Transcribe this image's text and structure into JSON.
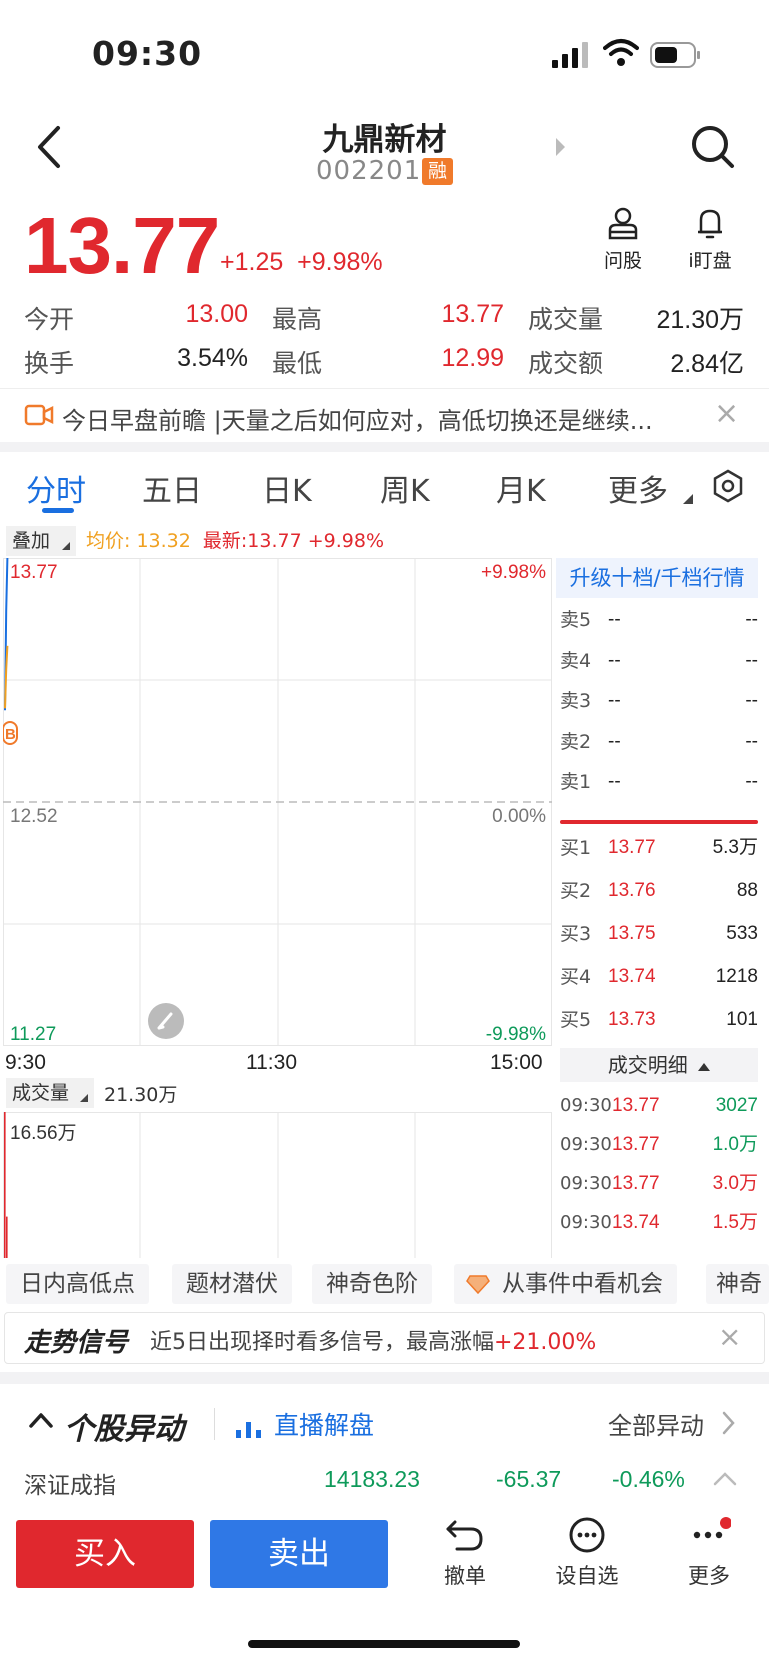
{
  "status": {
    "time": "09:30"
  },
  "header": {
    "name": "九鼎新材",
    "code": "002201",
    "badge": "融"
  },
  "price": {
    "last": "13.77",
    "change": "+1.25",
    "change_pct": "+9.98%"
  },
  "actions": {
    "ask_stock": "问股",
    "watch": "i盯盘"
  },
  "quote": {
    "open_label": "今开",
    "open": "13.00",
    "high_label": "最高",
    "high": "13.77",
    "volume_label": "成交量",
    "volume": "21.30万",
    "turnover_label": "换手",
    "turnover": "3.54%",
    "low_label": "最低",
    "low": "12.99",
    "amount_label": "成交额",
    "amount": "2.84亿"
  },
  "news": {
    "text": "今日早盘前瞻 |天量之后如何应对，高低切换还是继续..."
  },
  "tabs": [
    "分时",
    "五日",
    "日K",
    "周K",
    "月K",
    "更多"
  ],
  "chart_bar": {
    "overlay": "叠加",
    "avg": "均价: 13.32",
    "latest": "最新:13.77 +9.98%"
  },
  "chart_data": {
    "type": "line",
    "x_ticks": [
      "9:30",
      "11:30",
      "15:00"
    ],
    "y_left": [
      "13.77",
      "12.52",
      "11.27"
    ],
    "y_right": [
      "+9.98%",
      "0.00%",
      "-9.98%"
    ],
    "ylim": [
      11.27,
      13.77
    ],
    "series": [
      {
        "name": "最新",
        "x": [
          "9:30",
          "9:31",
          "9:32"
        ],
        "values": [
          12.99,
          13.5,
          13.77
        ]
      },
      {
        "name": "均价",
        "x": [
          "9:30",
          "9:31",
          "9:32"
        ],
        "values": [
          13.0,
          13.2,
          13.32
        ]
      }
    ],
    "marker": "B",
    "volume": {
      "label": "成交量",
      "total": "21.30万",
      "max_label": "16.56万",
      "bars": [
        16.56,
        4.7
      ]
    }
  },
  "orderbook": {
    "upgrade": "升级十档/千档行情",
    "asks": [
      {
        "label": "卖5",
        "price": "--",
        "vol": "--"
      },
      {
        "label": "卖4",
        "price": "--",
        "vol": "--"
      },
      {
        "label": "卖3",
        "price": "--",
        "vol": "--"
      },
      {
        "label": "卖2",
        "price": "--",
        "vol": "--"
      },
      {
        "label": "卖1",
        "price": "--",
        "vol": "--"
      }
    ],
    "bids": [
      {
        "label": "买1",
        "price": "13.77",
        "vol": "5.3万"
      },
      {
        "label": "买2",
        "price": "13.76",
        "vol": "88"
      },
      {
        "label": "买3",
        "price": "13.75",
        "vol": "533"
      },
      {
        "label": "买4",
        "price": "13.74",
        "vol": "1218"
      },
      {
        "label": "买5",
        "price": "13.73",
        "vol": "101"
      }
    ],
    "trades_title": "成交明细",
    "trades": [
      {
        "time": "09:30",
        "price": "13.77",
        "vol": "3027",
        "color": "#0e9a5a"
      },
      {
        "time": "09:30",
        "price": "13.77",
        "vol": "1.0万",
        "color": "#0e9a5a"
      },
      {
        "time": "09:30",
        "price": "13.77",
        "vol": "3.0万",
        "color": "#e0282e"
      },
      {
        "time": "09:30",
        "price": "13.74",
        "vol": "1.5万",
        "color": "#e0282e"
      }
    ]
  },
  "chips": [
    "日内高低点",
    "题材潜伏",
    "神奇色阶",
    "从事件中看机会",
    "神奇"
  ],
  "signal": {
    "title": "走势信号",
    "text": "近5日出现择时看多信号，最高涨幅",
    "pct": "+21.00%"
  },
  "abnormal": {
    "title": "个股异动",
    "live": "直播解盘",
    "all": "全部异动"
  },
  "index": {
    "name": "深证成指",
    "value": "14183.23",
    "change": "-65.37",
    "pct": "-0.46%"
  },
  "bottom": {
    "buy": "买入",
    "sell": "卖出",
    "cancel": "撤单",
    "watchlist": "设自选",
    "more": "更多"
  },
  "colors": {
    "up": "#e0282e",
    "down": "#0e9a5a",
    "accent": "#1a6fe0",
    "sell": "#2f78e6",
    "avg": "#f0a020"
  }
}
